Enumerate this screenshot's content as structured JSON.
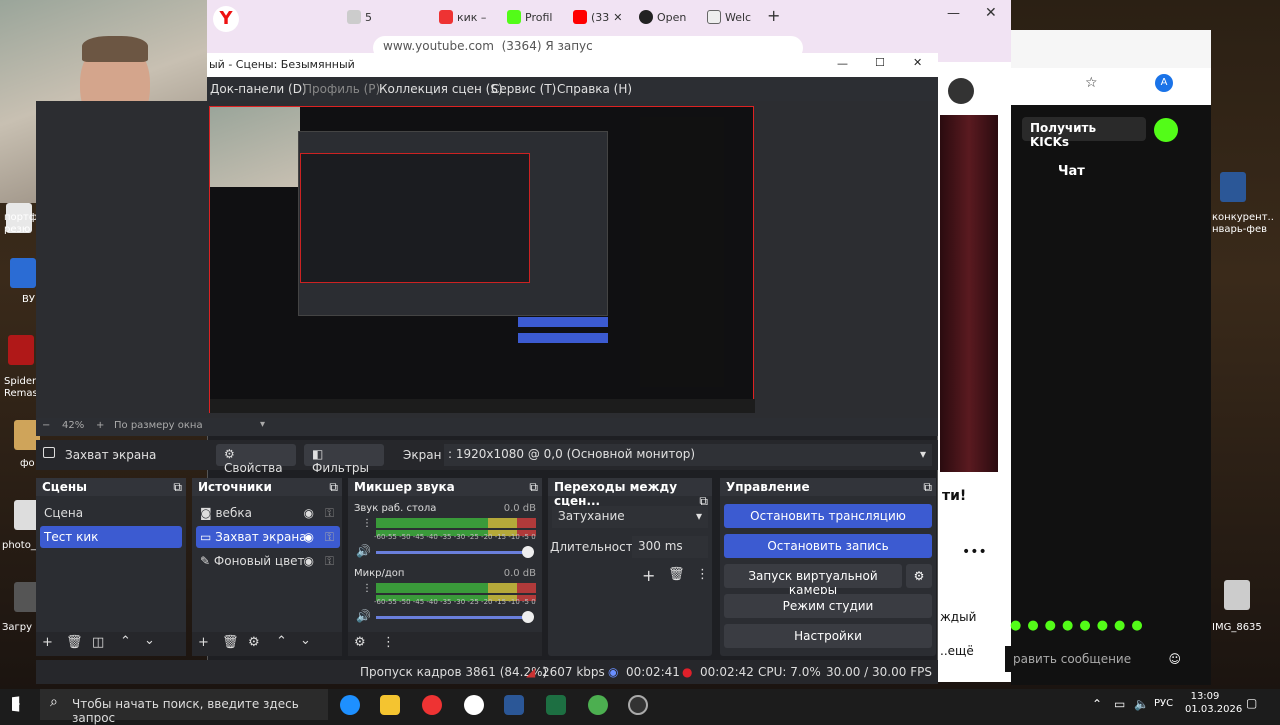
{
  "desktop": {
    "left_icons": [
      {
        "label": "портф... + резю"
      },
      {
        "label": "ВУ"
      },
      {
        "label": "Spider Remas"
      },
      {
        "label": "фо"
      },
      {
        "label": "photo_"
      },
      {
        "label": "Загру"
      }
    ],
    "right_icons": [
      {
        "label": "конкурент.. нварь-фев"
      },
      {
        "label": "IMG_8635"
      }
    ]
  },
  "browser": {
    "tabs": [
      "кик –",
      "Profil",
      "(33",
      "Open",
      "Welc"
    ],
    "address": "www.youtube.com",
    "address_title": "(3364) Я запус",
    "tab_badge": "5"
  },
  "kick": {
    "get_kicks_label": "Получить KICKs",
    "chat_label": "Чат",
    "chat_placeholder": "равить сообщение",
    "avatar_letter": "A",
    "partial_text1": "ти!",
    "partial_text2": "ждый",
    "partial_text3": "..ещё"
  },
  "obs": {
    "title": "ый - Сцены: Безымянный",
    "menu": [
      "Док-панели (D)",
      "Профиль (P)",
      "Коллекция сцен (S)",
      "Сервис (T)",
      "Справка (H)"
    ],
    "zoom": {
      "percent": "42%",
      "mode": "По размеру окна"
    },
    "source_toolbar": {
      "source_name": "Захват экрана",
      "properties": "Свойства",
      "filters": "Фильтры",
      "screen_label": "Экран",
      "screen_value": ": 1920x1080 @ 0,0 (Основной монитор)"
    },
    "scenes": {
      "title": "Сцены",
      "items": [
        {
          "label": "Сцена"
        },
        {
          "label": "Тест кик"
        }
      ]
    },
    "sources": {
      "title": "Источники",
      "items": [
        {
          "label": "вебка"
        },
        {
          "label": "Захват экрана"
        },
        {
          "label": "Фоновый цвет"
        }
      ]
    },
    "mixer": {
      "title": "Микшер звука",
      "channels": [
        {
          "name": "Звук раб. стола",
          "db": "0.0 dB",
          "level": 0.7
        },
        {
          "name": "Микр/доп",
          "db": "0.0 dB",
          "level": 0.72
        }
      ],
      "scale": "-60-55 -50 -45 -40 -35 -30 -25 -20 -15 -10 -5 0"
    },
    "transitions": {
      "title": "Переходы между сцен...",
      "selected": "Затухание",
      "duration_label": "Длительность",
      "duration_value": "300 ms"
    },
    "controls": {
      "title": "Управление",
      "stop_stream": "Остановить трансляцию",
      "stop_record": "Остановить запись",
      "virtual_cam": "Запуск виртуальной камеры",
      "studio_mode": "Режим студии",
      "settings": "Настройки"
    },
    "status": {
      "dropped": "Пропуск кадров 3861 (84.2%)",
      "bitrate": "2607 kbps",
      "stream_time": "00:02:41",
      "rec_time": "00:02:42",
      "cpu": "CPU: 7.0%",
      "fps": "30.00 / 30.00 FPS"
    }
  },
  "taskbar": {
    "search_placeholder": "Чтобы начать поиск, введите здесь запрос",
    "lang": "РУС",
    "time": "13:09",
    "date": "01.03.2026"
  },
  "colors": {
    "accent": "#3c5bd1",
    "kick_green": "#53fc18",
    "rec_red": "#e0202a"
  }
}
